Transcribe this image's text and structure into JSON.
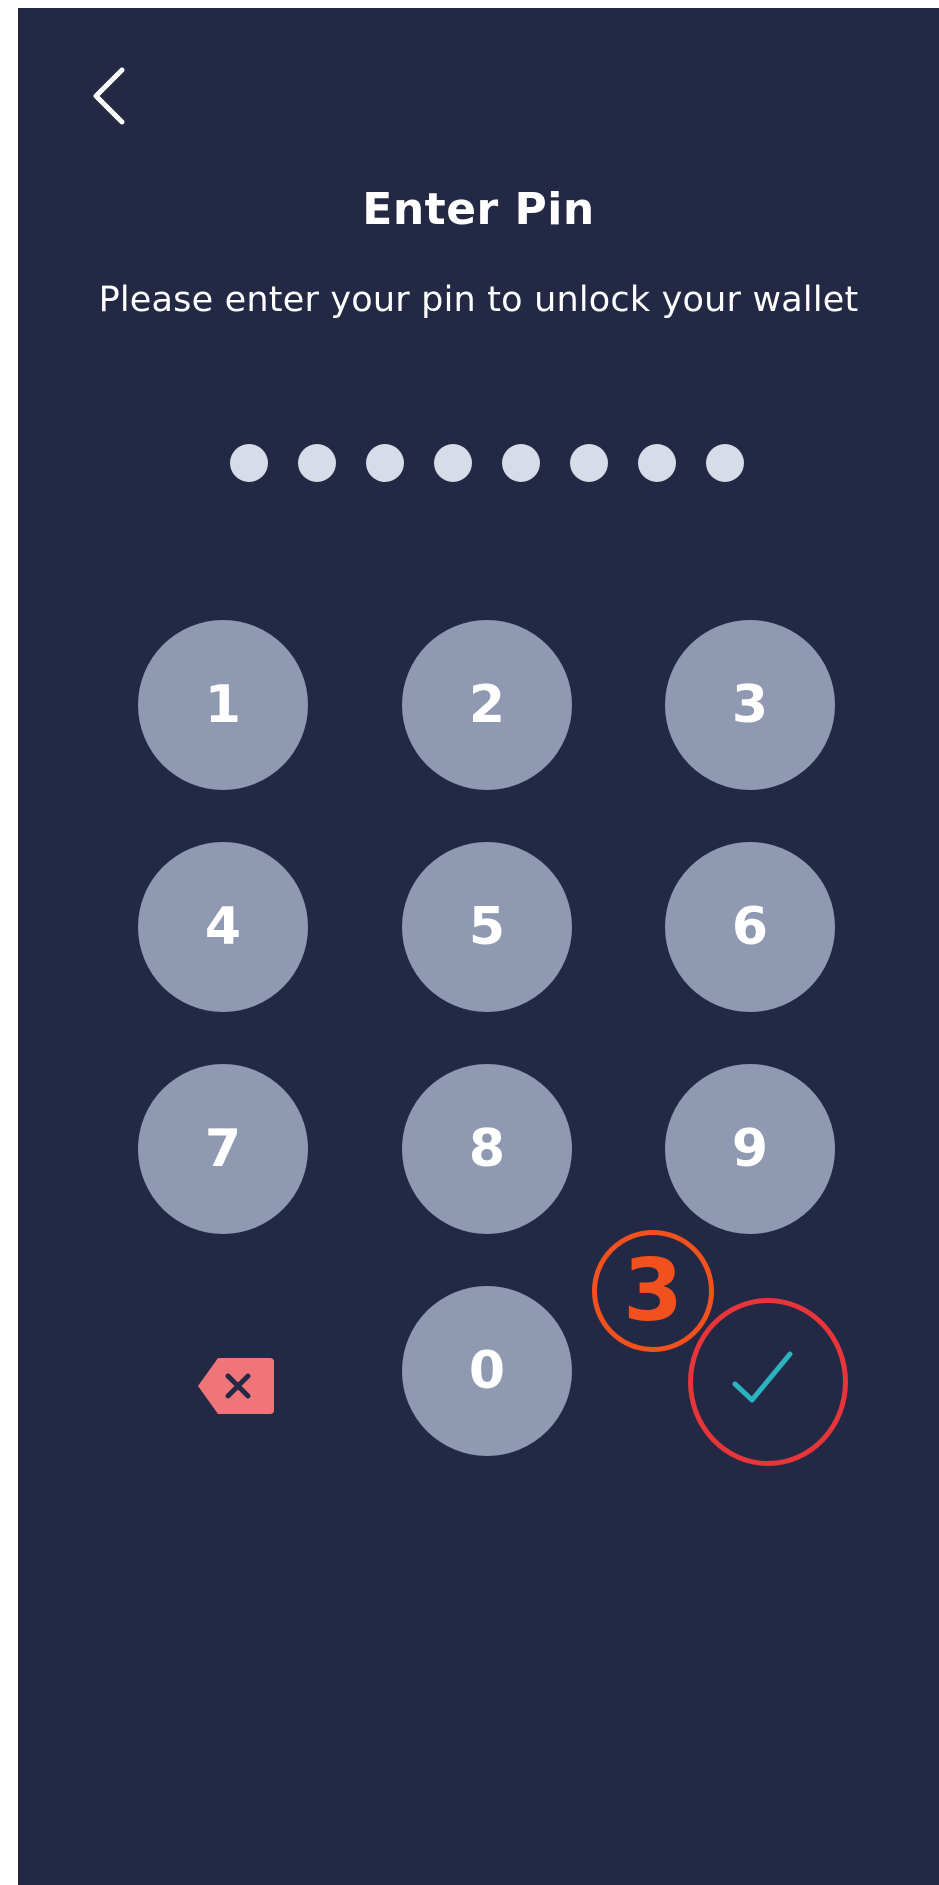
{
  "header": {
    "back_icon": "chevron-left-icon",
    "title": "Enter Pin",
    "subtitle": "Please enter your pin to unlock your wallet"
  },
  "pin": {
    "entered_count": 8
  },
  "keypad": {
    "keys": [
      "1",
      "2",
      "3",
      "4",
      "5",
      "6",
      "7",
      "8",
      "9",
      "0"
    ],
    "delete_icon": "backspace-icon",
    "confirm_icon": "check-icon"
  },
  "annotation": {
    "step_number": "3"
  },
  "colors": {
    "background": "#232944",
    "key_fill": "#9099b2",
    "dot_fill": "#d7dce9",
    "delete_red": "#f0757a",
    "check_teal": "#2bb3c0",
    "highlight_red": "#e8353a",
    "marker_orange": "#f2501d"
  }
}
